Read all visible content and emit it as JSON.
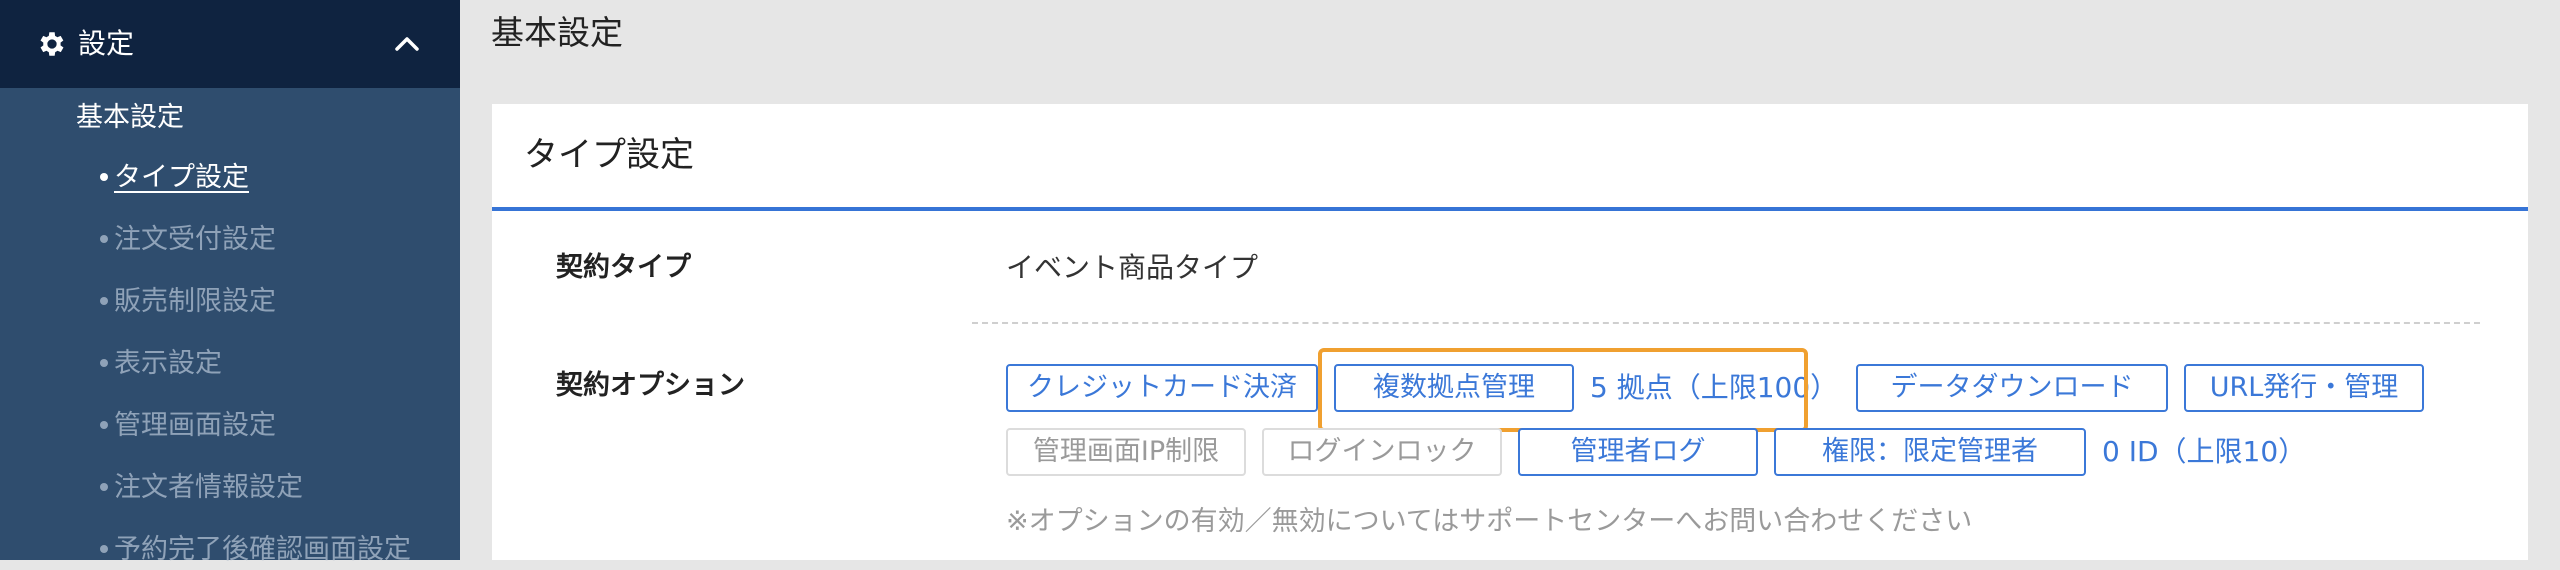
{
  "sidebar": {
    "header_label": "設定",
    "group_label": "基本設定",
    "items": [
      {
        "label": "タイプ設定"
      },
      {
        "label": "注文受付設定"
      },
      {
        "label": "販売制限設定"
      },
      {
        "label": "表示設定"
      },
      {
        "label": "管理画面設定"
      },
      {
        "label": "注文者情報設定"
      },
      {
        "label": "予約完了後確認画面設定"
      }
    ]
  },
  "main": {
    "page_title": "基本設定",
    "card_title": "タイプ設定",
    "contract_type_label": "契約タイプ",
    "contract_type_value": "イベント商品タイプ",
    "contract_options_label": "契約オプション",
    "options": {
      "credit_card": "クレジットカード決済",
      "multi_location": "複数拠点管理",
      "multi_location_count": "5 拠点（上限100）",
      "data_download": "データダウンロード",
      "url_issue": "URL発行・管理",
      "ip_restrict": "管理画面IP制限",
      "login_lock": "ログインロック",
      "admin_log": "管理者ログ",
      "limited_admin": "権限：限定管理者",
      "limited_admin_count": "0 ID（上限10）"
    },
    "note": "※オプションの有効／無効についてはサポートセンターへお問い合わせください"
  },
  "colors": {
    "sidebar_bg": "#2f4d6e",
    "sidebar_header_bg": "#0f2340",
    "accent_blue": "#3b78d8",
    "highlight_orange": "#f0a030"
  },
  "icons": {
    "header_icon": "gear-icon",
    "collapse_icon": "chevron-up-icon"
  }
}
